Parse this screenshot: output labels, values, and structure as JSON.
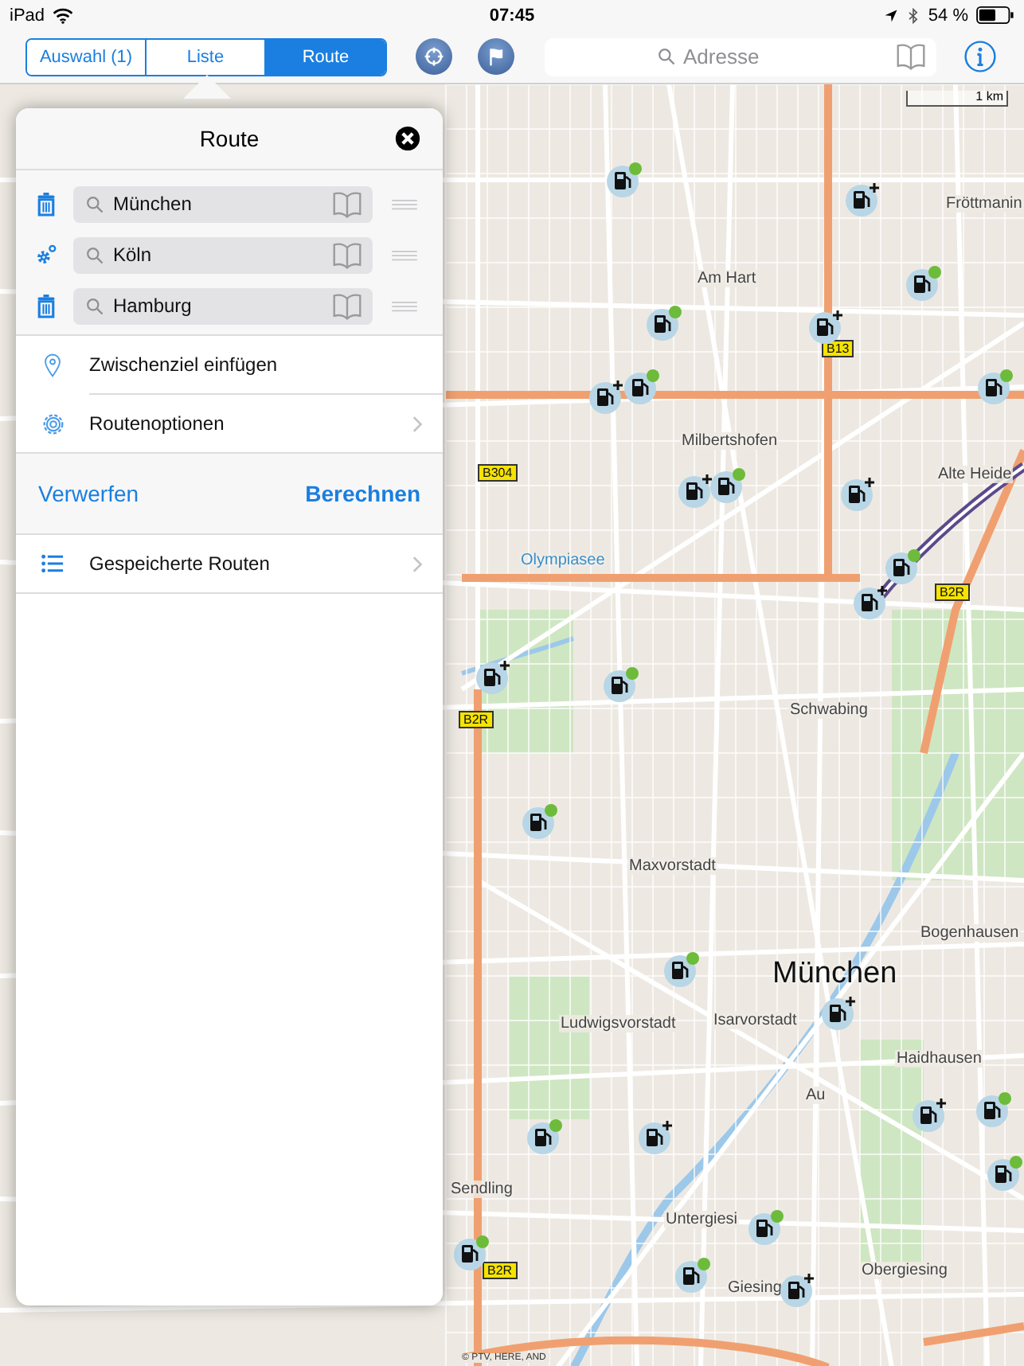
{
  "status_bar": {
    "device": "iPad",
    "time": "07:45",
    "battery": "54 %"
  },
  "toolbar": {
    "segments": [
      {
        "label": "Auswahl (1)",
        "selected": false
      },
      {
        "label": "Liste",
        "selected": false
      },
      {
        "label": "Route",
        "selected": true
      }
    ],
    "search": {
      "placeholder": "Adresse"
    }
  },
  "route_panel": {
    "title": "Route",
    "stops": [
      {
        "kind": "delete",
        "value": "München"
      },
      {
        "kind": "options",
        "value": "Köln"
      },
      {
        "kind": "delete",
        "value": "Hamburg"
      }
    ],
    "menu": [
      {
        "kind": "pin",
        "label": "Zwischenziel einfügen",
        "chevron": false
      },
      {
        "kind": "gear",
        "label": "Routenoptionen",
        "chevron": true
      }
    ],
    "discard": "Verwerfen",
    "calculate": "Berechnen",
    "saved": {
      "label": "Gespeicherte Routen",
      "chevron": true
    }
  },
  "map": {
    "scale": "1 km",
    "copyright": "© PTV, HERE, AND",
    "labels": [
      {
        "kind": "place",
        "text": "Fröttmanin"
      },
      {
        "kind": "place",
        "text": "Am Hart"
      },
      {
        "kind": "place",
        "text": "Milbertshofen"
      },
      {
        "kind": "place",
        "text": "Alte Heide"
      },
      {
        "kind": "water",
        "text": "Olympiasee"
      },
      {
        "kind": "place",
        "text": "Schwabing"
      },
      {
        "kind": "place",
        "text": "Maxvorstadt"
      },
      {
        "kind": "city",
        "text": "München"
      },
      {
        "kind": "place",
        "text": "Isarvorstadt"
      },
      {
        "kind": "place",
        "text": "Ludwigsvorstadt"
      },
      {
        "kind": "place",
        "text": "Bogenhausen"
      },
      {
        "kind": "place",
        "text": "Haidhausen"
      },
      {
        "kind": "place",
        "text": "Au"
      },
      {
        "kind": "place",
        "text": "Sendling"
      },
      {
        "kind": "place",
        "text": "Untergiesi"
      },
      {
        "kind": "place",
        "text": "Giesing"
      },
      {
        "kind": "place",
        "text": "Obergiesing"
      },
      {
        "kind": "road",
        "text": "B13"
      },
      {
        "kind": "road",
        "text": "B304"
      },
      {
        "kind": "road",
        "text": "B2R"
      },
      {
        "kind": "road",
        "text": "B2R"
      },
      {
        "kind": "road",
        "text": "B2R"
      }
    ],
    "stations": [
      {
        "kind": "dot"
      },
      {
        "kind": "plus"
      },
      {
        "kind": "dot"
      },
      {
        "kind": "dot"
      },
      {
        "kind": "plus"
      },
      {
        "kind": "plus"
      },
      {
        "kind": "dot"
      },
      {
        "kind": "dot"
      },
      {
        "kind": "plus"
      },
      {
        "kind": "dot"
      },
      {
        "kind": "plus"
      },
      {
        "kind": "dot"
      },
      {
        "kind": "plus"
      },
      {
        "kind": "plus"
      },
      {
        "kind": "dot"
      },
      {
        "kind": "dot"
      },
      {
        "kind": "dot"
      },
      {
        "kind": "plus"
      },
      {
        "kind": "dot"
      },
      {
        "kind": "plus"
      },
      {
        "kind": "dot"
      },
      {
        "kind": "plus"
      },
      {
        "kind": "dot"
      },
      {
        "kind": "dot"
      },
      {
        "kind": "dot"
      },
      {
        "kind": "dot"
      },
      {
        "kind": "plus"
      }
    ]
  }
}
